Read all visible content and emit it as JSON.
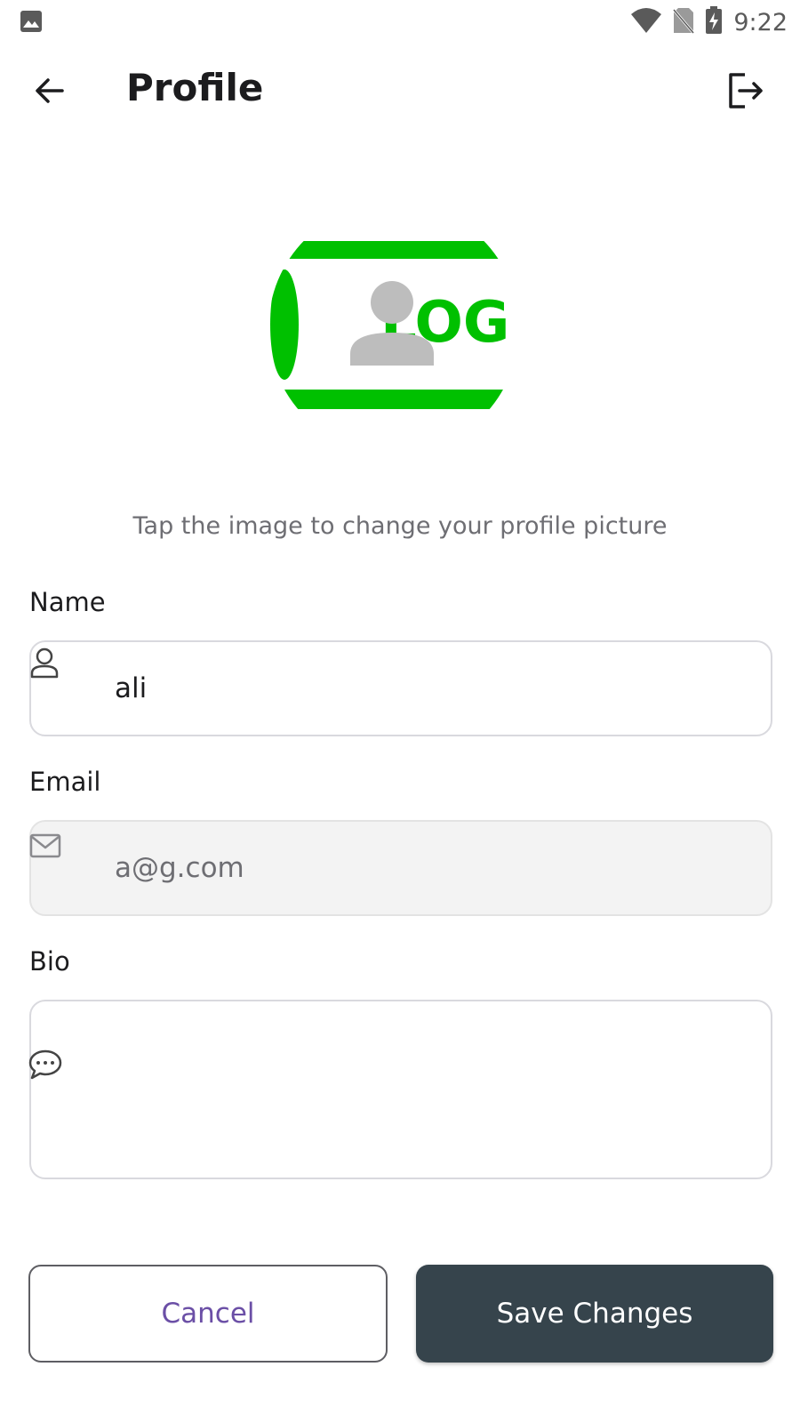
{
  "status_bar": {
    "time": "9:22",
    "icons": [
      "image-icon",
      "wifi-icon",
      "no-sim-icon",
      "battery-charging-icon"
    ]
  },
  "header": {
    "title": "Profile",
    "back_icon": "arrow-left-icon",
    "logout_icon": "logout-icon"
  },
  "avatar": {
    "logo_text": "LOG",
    "colors": {
      "green": "#00c000",
      "placeholder_gray": "#bdbdbd"
    }
  },
  "hint_text": "Tap the image to change your profile picture",
  "form": {
    "name": {
      "label": "Name",
      "value": "ali",
      "icon": "user-icon"
    },
    "email": {
      "label": "Email",
      "value": "a@g.com",
      "icon": "mail-icon",
      "disabled": true
    },
    "bio": {
      "label": "Bio",
      "value": "",
      "icon": "chat-bubble-icon"
    }
  },
  "actions": {
    "cancel_label": "Cancel",
    "save_label": "Save Changes"
  },
  "colors": {
    "save_button_bg": "#36444c",
    "cancel_text": "#6b4fa6",
    "border": "#d9d9de"
  }
}
